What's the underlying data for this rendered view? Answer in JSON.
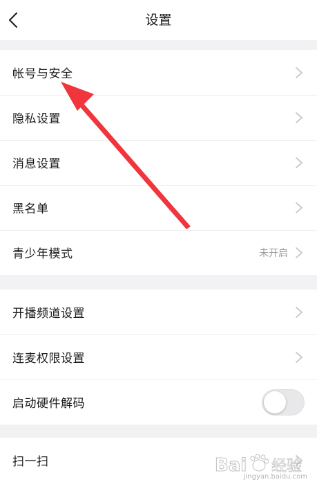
{
  "nav": {
    "title": "设置"
  },
  "groups": [
    {
      "items": [
        {
          "label": "帐号与安全"
        },
        {
          "label": "隐私设置"
        },
        {
          "label": "消息设置"
        },
        {
          "label": "黑名单"
        },
        {
          "label": "青少年模式",
          "value": "未开启"
        }
      ]
    },
    {
      "items": [
        {
          "label": "开播频道设置"
        },
        {
          "label": "连麦权限设置"
        },
        {
          "label": "启动硬件解码",
          "toggle": false
        }
      ]
    },
    {
      "items": [
        {
          "label": "扫一扫"
        }
      ]
    }
  ],
  "watermark": {
    "text": "Bai du 经验",
    "sub": "jingyan.baidu.com"
  },
  "colors": {
    "annotation_arrow": "#f0353c",
    "chevron": "#c4c4c6"
  }
}
